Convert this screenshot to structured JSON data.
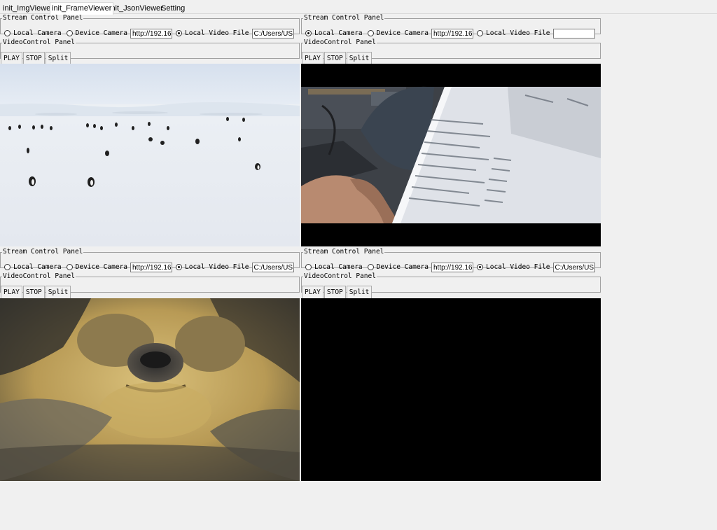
{
  "tabs": [
    {
      "label": "init_ImgViewer",
      "active": false
    },
    {
      "label": "init_FrameViewer",
      "active": true
    },
    {
      "label": "init_JsonViewer",
      "active": false
    },
    {
      "label": "Setting",
      "active": false
    }
  ],
  "labels": {
    "stream_panel": "Stream Control Panel",
    "video_panel": "VideoControl Panel",
    "local_camera": "Local Camera",
    "device_camera": "Device Camera",
    "local_video_file": "Local Video File",
    "play": "PLAY",
    "stop": "STOP",
    "split": "Split"
  },
  "cells": [
    {
      "url": "http://192.16",
      "file": "C:/Users/USE",
      "selected": "local_video_file"
    },
    {
      "url": "http://192.16",
      "file": "",
      "selected": "local_camera"
    },
    {
      "url": "http://192.16",
      "file": "C:/Users/USE",
      "selected": "local_video_file"
    },
    {
      "url": "http://192.16",
      "file": "C:/Users/USE",
      "selected": "local_video_file"
    }
  ],
  "videos": [
    {
      "content": "penguins-on-ice"
    },
    {
      "content": "webcam-person-with-document"
    },
    {
      "content": "otter-closeup"
    },
    {
      "content": "empty-black"
    }
  ],
  "colors": {
    "window_bg": "#f0f0f0",
    "video_bg": "#000000"
  }
}
